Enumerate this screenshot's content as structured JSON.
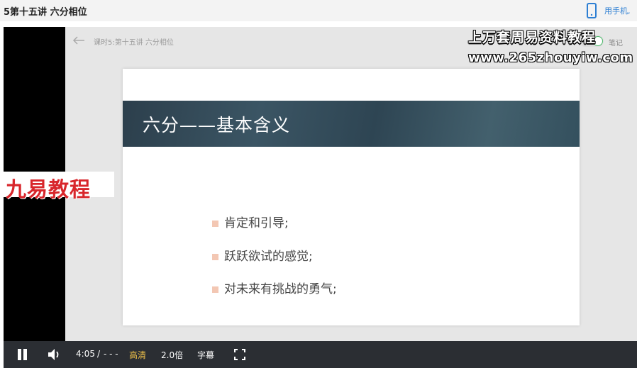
{
  "header": {
    "title": "5第十五讲 六分相位",
    "phone_link": "用手机,"
  },
  "player": {
    "lesson_title": "课时5:第十五讲 六分相位",
    "notes_label": "笔记",
    "watermark_line1": "上万套周易资料教程",
    "watermark_line2": "www.265zhouyiw.com",
    "watermark_left": "九易教程"
  },
  "slide": {
    "heading": "六分——基本含义",
    "bullets": [
      "肯定和引导;",
      "跃跃欲试的感觉;",
      "对未来有挑战的勇气;"
    ]
  },
  "controls": {
    "current_time": "4:05",
    "separator": "/",
    "duration": "- - -",
    "quality": "高清",
    "speed": "2.0倍",
    "subtitles": "字幕"
  },
  "colors": {
    "accent_blue": "#2d7fd3",
    "quality_yellow": "#f0c24a",
    "control_bar": "#2b2e33",
    "toggle_green": "#4bb96a"
  }
}
